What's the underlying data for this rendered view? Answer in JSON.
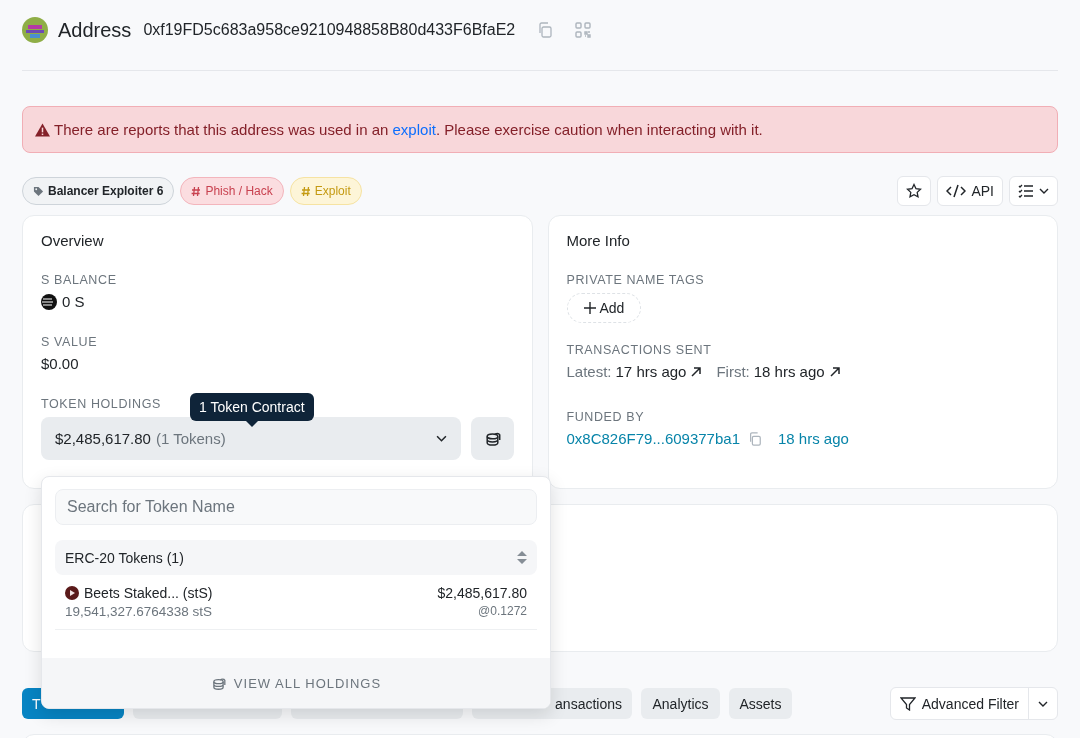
{
  "header": {
    "title": "Address",
    "address": "0xf19FD5c683a958ce9210948858B80d433F6BfaE2"
  },
  "alert": {
    "before": "There are reports that this address was used in an ",
    "link": "exploit",
    "after": ". Please exercise caution when interacting with it."
  },
  "tags": [
    {
      "kind": "label",
      "text": "Balancer Exploiter 6"
    },
    {
      "kind": "phish",
      "text": "Phish / Hack"
    },
    {
      "kind": "exploit",
      "text": "Exploit"
    }
  ],
  "api_button": "API",
  "overview": {
    "title": "Overview",
    "balance_label": "S BALANCE",
    "balance": "0 S",
    "value_label": "S VALUE",
    "value": "$0.00",
    "holdings_label": "TOKEN HOLDINGS",
    "holdings_value": "$2,485,617.80",
    "holdings_count": "(1 Tokens)",
    "tooltip": "1 Token Contract"
  },
  "more_info": {
    "title": "More Info",
    "tags_label": "PRIVATE NAME TAGS",
    "add_button": "Add",
    "sent_label": "TRANSACTIONS SENT",
    "latest_label": "Latest:",
    "latest": "17 hrs ago",
    "first_label": "First:",
    "first": "18 hrs ago",
    "funded_label": "FUNDED BY",
    "funded_address": "0x8C826F79...609377ba1",
    "funded_time": "18 hrs ago"
  },
  "token_menu": {
    "search": {
      "placeholder": "Search for Token Name"
    },
    "group": "ERC-20 Tokens (1)",
    "items": [
      {
        "name": "Beets Staked... (stS)",
        "amount": "19,541,327.6764338 stS",
        "value": "$2,485,617.80",
        "price": "@0.1272"
      }
    ],
    "footer": "VIEW ALL HOLDINGS"
  },
  "tabs": [
    {
      "label": "T",
      "selected": true
    },
    {
      "selected": false
    },
    {
      "selected": false
    },
    {
      "label": "ansactions",
      "selected": false
    },
    {
      "label": "Analytics",
      "selected": false
    },
    {
      "label": "Assets",
      "selected": false
    }
  ],
  "filter_button": "Advanced Filter"
}
